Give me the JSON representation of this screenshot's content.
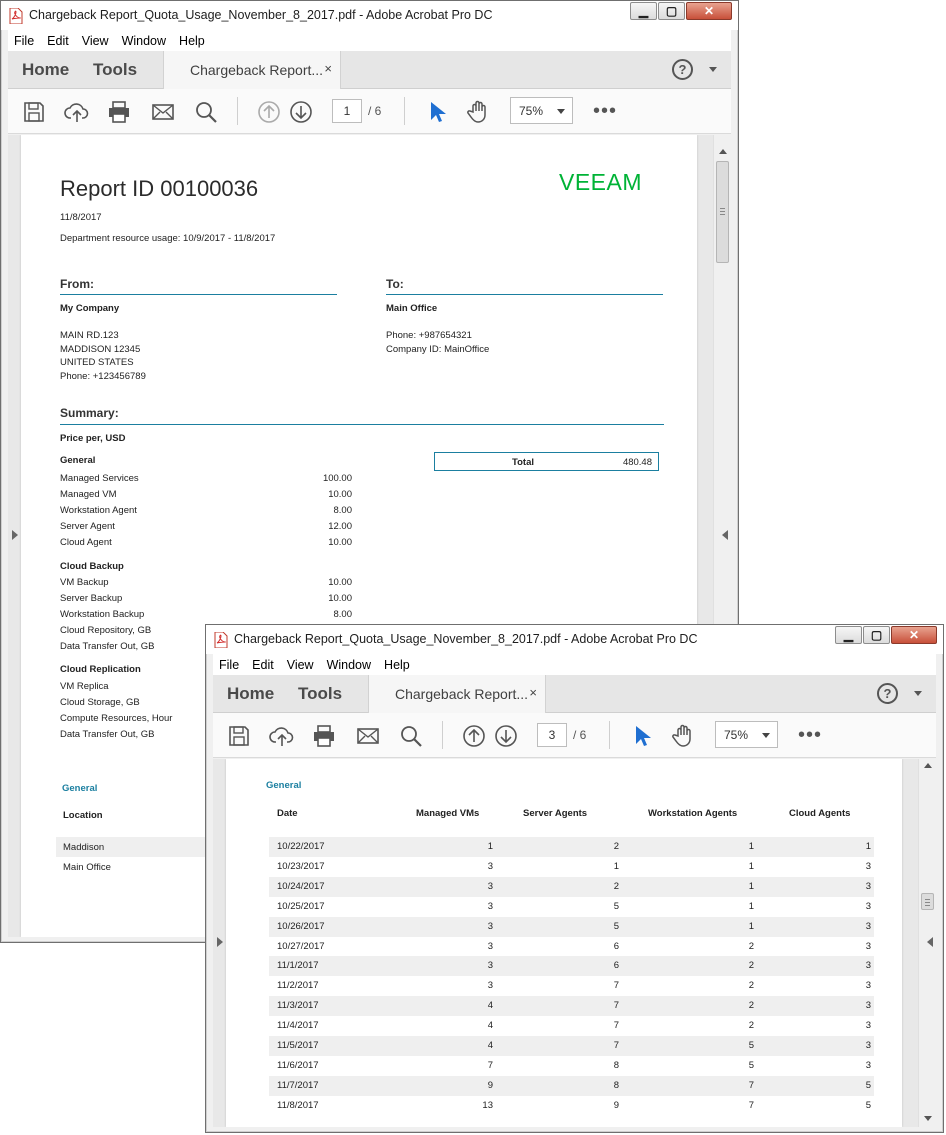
{
  "window_title": "Chargeback Report_Quota_Usage_November_8_2017.pdf - Adobe Acrobat Pro DC",
  "menu": [
    "File",
    "Edit",
    "View",
    "Window",
    "Help"
  ],
  "nav": {
    "home": "Home",
    "tools": "Tools",
    "doc_tab": "Chargeback Report...",
    "close": "×",
    "help": "?"
  },
  "icons": {
    "save": "save-icon",
    "upload": "cloud-upload-icon",
    "print": "print-icon",
    "mail": "mail-icon",
    "search": "search-icon",
    "prev": "arrow-up-circle-icon",
    "next": "arrow-down-circle-icon",
    "select": "cursor-icon",
    "hand": "hand-icon",
    "more": "more-icon"
  },
  "win1": {
    "page": "1",
    "page_total": "/ 6",
    "zoom": "75%"
  },
  "win2": {
    "page": "3",
    "page_total": "/ 6",
    "zoom": "75%"
  },
  "more_label": "•••",
  "report": {
    "logo": "VEEAM",
    "title": "Report ID 00100036",
    "date": "11/8/2017",
    "usage": "Department resource usage: 10/9/2017 - 11/8/2017",
    "from_head": "From:",
    "from_name": "My Company",
    "from_addr1": "MAIN RD.123",
    "from_addr2": "MADDISON 12345",
    "from_addr3": "UNITED STATES",
    "from_phone": "Phone: +123456789",
    "to_head": "To:",
    "to_name": "Main Office",
    "to_phone": "Phone: +987654321",
    "to_company": "Company ID: MainOffice",
    "summary_head": "Summary:",
    "price_per": "Price per, USD",
    "total_label": "Total",
    "total_value": "480.48",
    "general_head": "General",
    "general": [
      {
        "label": "Managed Services",
        "value": "100.00"
      },
      {
        "label": "Managed VM",
        "value": "10.00"
      },
      {
        "label": "Workstation Agent",
        "value": "8.00"
      },
      {
        "label": "Server Agent",
        "value": "12.00"
      },
      {
        "label": "Cloud Agent",
        "value": "10.00"
      }
    ],
    "backup_head": "Cloud Backup",
    "backup": [
      {
        "label": "VM Backup",
        "value": "10.00"
      },
      {
        "label": "Server Backup",
        "value": "10.00"
      },
      {
        "label": "Workstation Backup",
        "value": "8.00"
      },
      {
        "label": "Cloud Repository, GB",
        "value": ""
      },
      {
        "label": "Data Transfer Out, GB",
        "value": ""
      }
    ],
    "replication_head": "Cloud Replication",
    "replication": [
      "VM Replica",
      "Cloud Storage, GB",
      "Compute Resources, Hour",
      "Data Transfer Out, GB"
    ],
    "general_link": "General",
    "location_head": "Location",
    "locations": [
      "Maddison",
      "Main Office"
    ]
  },
  "table": {
    "section": "General",
    "headers": [
      "Date",
      "Managed VMs",
      "Server Agents",
      "Workstation Agents",
      "Cloud Agents"
    ],
    "rows": [
      [
        "10/22/2017",
        "1",
        "2",
        "1",
        "1"
      ],
      [
        "10/23/2017",
        "3",
        "1",
        "1",
        "3"
      ],
      [
        "10/24/2017",
        "3",
        "2",
        "1",
        "3"
      ],
      [
        "10/25/2017",
        "3",
        "5",
        "1",
        "3"
      ],
      [
        "10/26/2017",
        "3",
        "5",
        "1",
        "3"
      ],
      [
        "10/27/2017",
        "3",
        "6",
        "2",
        "3"
      ],
      [
        "11/1/2017",
        "3",
        "6",
        "2",
        "3"
      ],
      [
        "11/2/2017",
        "3",
        "7",
        "2",
        "3"
      ],
      [
        "11/3/2017",
        "4",
        "7",
        "2",
        "3"
      ],
      [
        "11/4/2017",
        "4",
        "7",
        "2",
        "3"
      ],
      [
        "11/5/2017",
        "4",
        "7",
        "5",
        "3"
      ],
      [
        "11/6/2017",
        "7",
        "8",
        "5",
        "3"
      ],
      [
        "11/7/2017",
        "9",
        "8",
        "7",
        "5"
      ],
      [
        "11/8/2017",
        "13",
        "9",
        "7",
        "5"
      ]
    ]
  },
  "colors": {
    "accent": "#1b7fa0",
    "veeam_green": "#00b336",
    "cursor_blue": "#1f6fd1"
  }
}
